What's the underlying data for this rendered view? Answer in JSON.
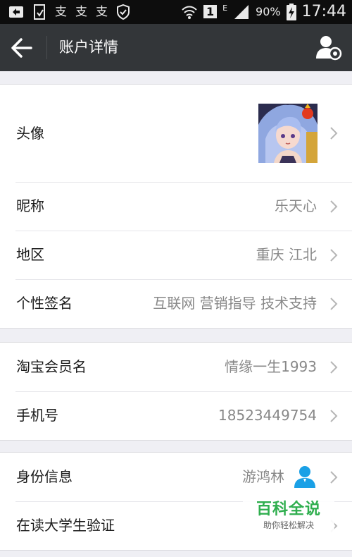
{
  "status_bar": {
    "left_icons": [
      "notification-icon",
      "sim-icon",
      "alipay-icon",
      "alipay-icon",
      "alipay-icon",
      "shield-icon"
    ],
    "sim_slot": "1",
    "network_type": "E",
    "battery": "90%",
    "time": "17:44"
  },
  "header": {
    "title": "账户详情",
    "back_icon": "back-arrow-icon",
    "profile_icon": "profile-settings-icon"
  },
  "section1": {
    "avatar_label": "头像",
    "nickname_label": "昵称",
    "nickname_value": "乐天心",
    "region_label": "地区",
    "region_value": "重庆 江北",
    "signature_label": "个性签名",
    "signature_value": "互联网 营销指导 技术支持"
  },
  "section2": {
    "taobao_label": "淘宝会员名",
    "taobao_value": "情缘一生1993",
    "phone_label": "手机号",
    "phone_value": "18523449754"
  },
  "section3": {
    "id_label": "身份信息",
    "id_value": "游鸿林",
    "student_label": "在读大学生验证"
  },
  "watermark": {
    "title": "百科全说",
    "subtitle": "助你轻松解决"
  },
  "colors": {
    "title_bar": "#333639",
    "background": "#efeff4",
    "value_text": "#888888",
    "person_icon": "#1aa0e6",
    "watermark_green": "#2fae4e"
  }
}
